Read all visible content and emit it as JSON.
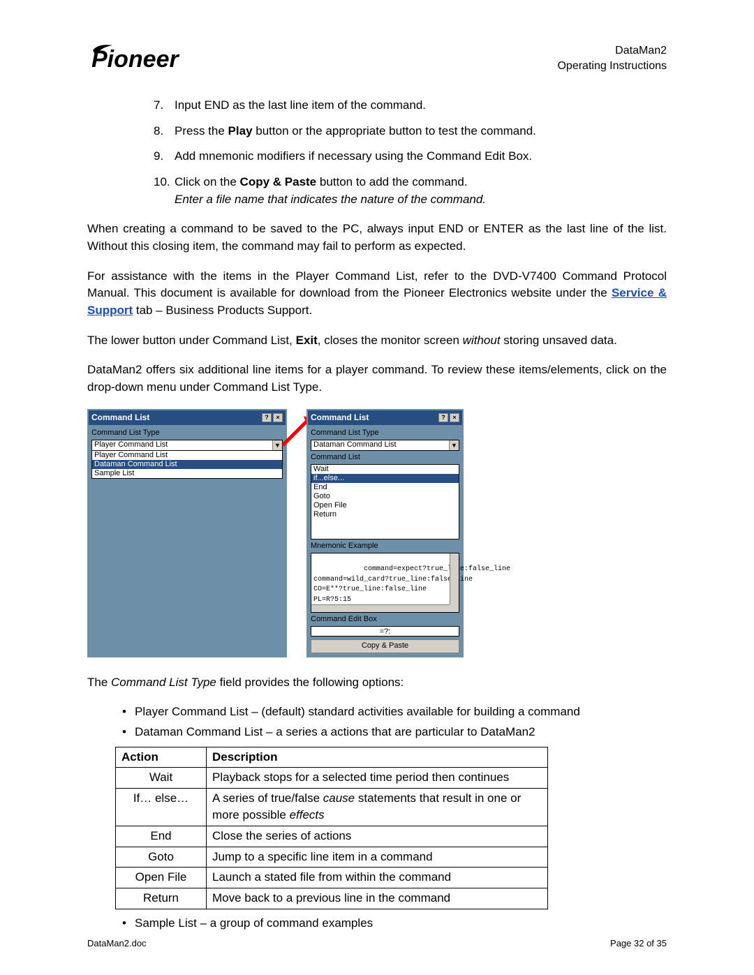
{
  "header": {
    "brand": "Pioneer",
    "doc_title": "DataMan2",
    "doc_sub": "Operating Instructions"
  },
  "steps": [
    {
      "num": "7.",
      "text": "Input END as the last line item of the command."
    },
    {
      "num": "8.",
      "prefix": "Press the ",
      "bold": "Play",
      "suffix": " button or the appropriate button to test the command."
    },
    {
      "num": "9.",
      "text": "Add mnemonic modifiers if necessary using the Command Edit Box."
    },
    {
      "num": "10.",
      "prefix": "Click on the ",
      "bold": "Copy & Paste",
      "suffix": " button to add the command.",
      "note": "Enter a file name that indicates the nature of the command."
    }
  ],
  "paragraphs": {
    "p1": "When creating a command to be saved to the PC, always input END or ENTER as the last line of the list.  Without this closing item, the command may fail to perform as expected.",
    "p2_a": "For assistance with the items in the Player Command List, refer to the DVD-V7400 Command Protocol Manual.  This document is available for download from the Pioneer Electronics website under the ",
    "p2_link": "Service & Support",
    "p2_b": " tab – Business Products Support.",
    "p3_a": "The lower button under Command List, ",
    "p3_bold": "Exit",
    "p3_b": ", closes the monitor screen ",
    "p3_ital": "without",
    "p3_c": " storing unsaved data.",
    "p4": "DataMan2 offers six additional line items for a player command.  To review these items/elements, click on the drop-down menu under Command List Type.",
    "p5_a": "The ",
    "p5_ital": "Command List Type",
    "p5_b": " field provides the following options:"
  },
  "dlg_left": {
    "title": "Command List",
    "lbl_type": "Command List Type",
    "combo_value": "Player Command List",
    "options": [
      "Player Command List",
      "Dataman Command List",
      "Sample List"
    ],
    "selected_index": 1
  },
  "dlg_right": {
    "title": "Command List",
    "lbl_type": "Command List Type",
    "combo_value": "Dataman Command List",
    "lbl_cmd": "Command List",
    "cmd_items": [
      "Wait",
      "if...else...",
      "End",
      "Goto",
      "Open File",
      "Return"
    ],
    "cmd_selected_index": 1,
    "lbl_mnemonic": "Mnemonic Example",
    "mnemonic_text": "command=expect?true_line:false_line\ncommand=wild_card?true_line:false_line\nCO=E**?true_line:false_line\nPL=R?5:15",
    "lbl_edit": "Command Edit Box",
    "edit_value": "=?:",
    "btn_copy": "Copy & Paste"
  },
  "options_list": {
    "intro_player": "Player Command List – (default) standard activities available for building a command",
    "intro_dataman": "Dataman Command List – a series a actions that are particular to DataMan2",
    "intro_sample": "Sample List – a group of command examples"
  },
  "table": {
    "head_action": "Action",
    "head_desc": "Description",
    "rows": [
      {
        "action": "Wait",
        "desc": "Playback stops for a selected time period then continues"
      },
      {
        "action": "If… else…",
        "desc_a": "A series of true/false ",
        "desc_i1": "cause",
        "desc_b": " statements that result in one or more possible ",
        "desc_i2": "effects"
      },
      {
        "action": "End",
        "desc": "Close the series of actions"
      },
      {
        "action": "Goto",
        "desc": "Jump to a specific line item in a command"
      },
      {
        "action": "Open File",
        "desc": "Launch a stated file from within the command"
      },
      {
        "action": "Return",
        "desc": "Move back to a previous line in the command"
      }
    ]
  },
  "footer": {
    "left": "DataMan2.doc",
    "right": "Page 32 of 35"
  }
}
